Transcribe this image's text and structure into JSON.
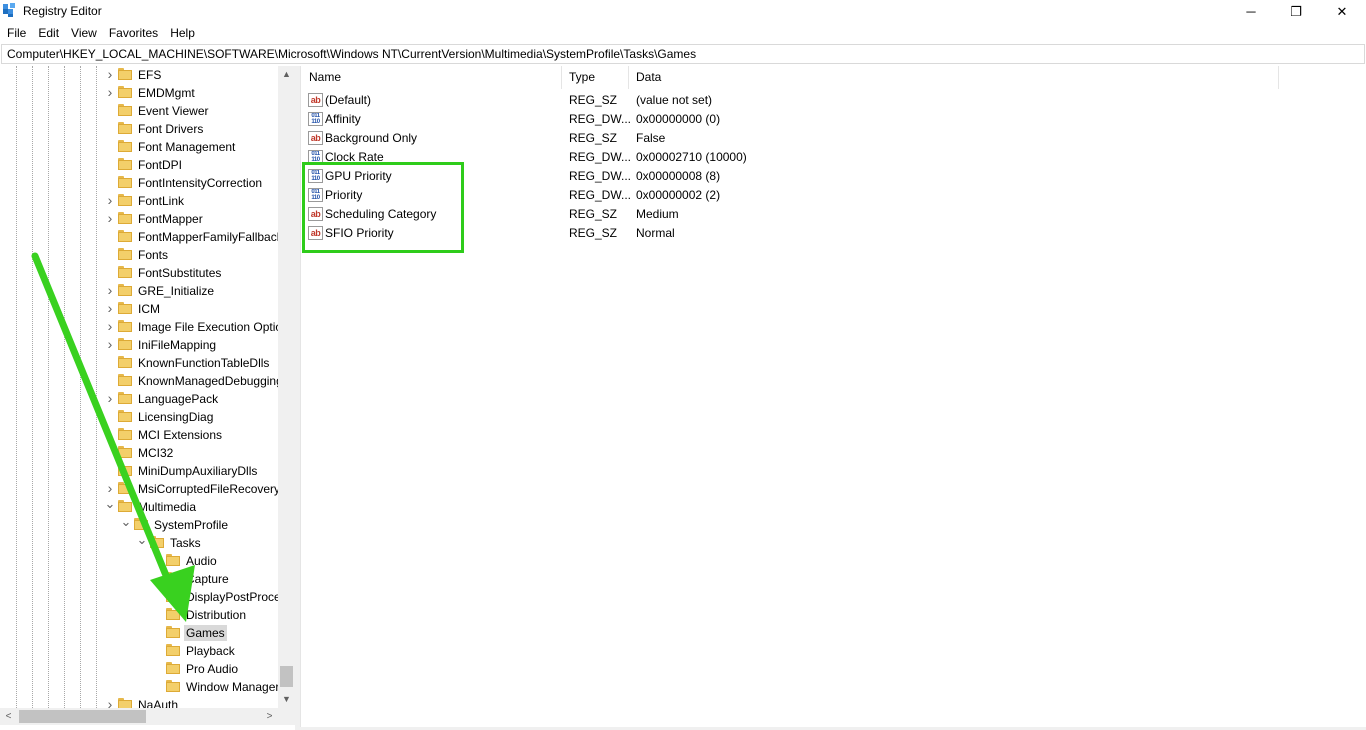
{
  "window": {
    "title": "Registry Editor",
    "controls": {
      "minimize": "─",
      "maximize": "❐",
      "close": "✕"
    }
  },
  "menu": {
    "items": [
      "File",
      "Edit",
      "View",
      "Favorites",
      "Help"
    ]
  },
  "address": {
    "path": "Computer\\HKEY_LOCAL_MACHINE\\SOFTWARE\\Microsoft\\Windows NT\\CurrentVersion\\Multimedia\\SystemProfile\\Tasks\\Games"
  },
  "tree": {
    "items": [
      {
        "label": "EFS",
        "expander": "collapsed"
      },
      {
        "label": "EMDMgmt",
        "expander": "collapsed"
      },
      {
        "label": "Event Viewer",
        "expander": "none"
      },
      {
        "label": "Font Drivers",
        "expander": "none"
      },
      {
        "label": "Font Management",
        "expander": "none"
      },
      {
        "label": "FontDPI",
        "expander": "none"
      },
      {
        "label": "FontIntensityCorrection",
        "expander": "none"
      },
      {
        "label": "FontLink",
        "expander": "collapsed"
      },
      {
        "label": "FontMapper",
        "expander": "collapsed"
      },
      {
        "label": "FontMapperFamilyFallback",
        "expander": "none"
      },
      {
        "label": "Fonts",
        "expander": "none"
      },
      {
        "label": "FontSubstitutes",
        "expander": "none"
      },
      {
        "label": "GRE_Initialize",
        "expander": "collapsed"
      },
      {
        "label": "ICM",
        "expander": "collapsed"
      },
      {
        "label": "Image File Execution Options",
        "expander": "collapsed"
      },
      {
        "label": "IniFileMapping",
        "expander": "collapsed"
      },
      {
        "label": "KnownFunctionTableDlls",
        "expander": "none"
      },
      {
        "label": "KnownManagedDebuggingDlls",
        "expander": "none"
      },
      {
        "label": "LanguagePack",
        "expander": "collapsed"
      },
      {
        "label": "LicensingDiag",
        "expander": "none"
      },
      {
        "label": "MCI Extensions",
        "expander": "none"
      },
      {
        "label": "MCI32",
        "expander": "none"
      },
      {
        "label": "MiniDumpAuxiliaryDlls",
        "expander": "none"
      },
      {
        "label": "MsiCorruptedFileRecovery",
        "expander": "collapsed"
      },
      {
        "label": "Multimedia",
        "expander": "expanded"
      },
      {
        "label": "SystemProfile",
        "expander": "expanded"
      },
      {
        "label": "Tasks",
        "expander": "expanded"
      },
      {
        "label": "Audio",
        "expander": "none"
      },
      {
        "label": "Capture",
        "expander": "none"
      },
      {
        "label": "DisplayPostProcessing",
        "expander": "none"
      },
      {
        "label": "Distribution",
        "expander": "none"
      },
      {
        "label": "Games",
        "expander": "none",
        "selected": true
      },
      {
        "label": "Playback",
        "expander": "none"
      },
      {
        "label": "Pro Audio",
        "expander": "none"
      },
      {
        "label": "Window Manager",
        "expander": "none"
      },
      {
        "label": "NaAuth",
        "expander": "collapsed"
      }
    ]
  },
  "list": {
    "columns": [
      "Name",
      "Type",
      "Data"
    ],
    "rows": [
      {
        "icon": "string-value-icon",
        "name": "(Default)",
        "type": "REG_SZ",
        "data": "(value not set)"
      },
      {
        "icon": "dword-value-icon",
        "name": "Affinity",
        "type": "REG_DW...",
        "data": "0x00000000 (0)"
      },
      {
        "icon": "string-value-icon",
        "name": "Background Only",
        "type": "REG_SZ",
        "data": "False"
      },
      {
        "icon": "dword-value-icon",
        "name": "Clock Rate",
        "type": "REG_DW...",
        "data": "0x00002710 (10000)"
      },
      {
        "icon": "dword-value-icon",
        "name": "GPU Priority",
        "type": "REG_DW...",
        "data": "0x00000008 (8)"
      },
      {
        "icon": "dword-value-icon",
        "name": "Priority",
        "type": "REG_DW...",
        "data": "0x00000002 (2)"
      },
      {
        "icon": "string-value-icon",
        "name": "Scheduling Category",
        "type": "REG_SZ",
        "data": "Medium"
      },
      {
        "icon": "string-value-icon",
        "name": "SFIO Priority",
        "type": "REG_SZ",
        "data": "Normal"
      }
    ],
    "icon_glyphs": {
      "string": "ab",
      "dword": "011 110"
    }
  },
  "annotation": {
    "highlight_color": "#2ecc1a",
    "arrow_color": "#39d11f"
  }
}
